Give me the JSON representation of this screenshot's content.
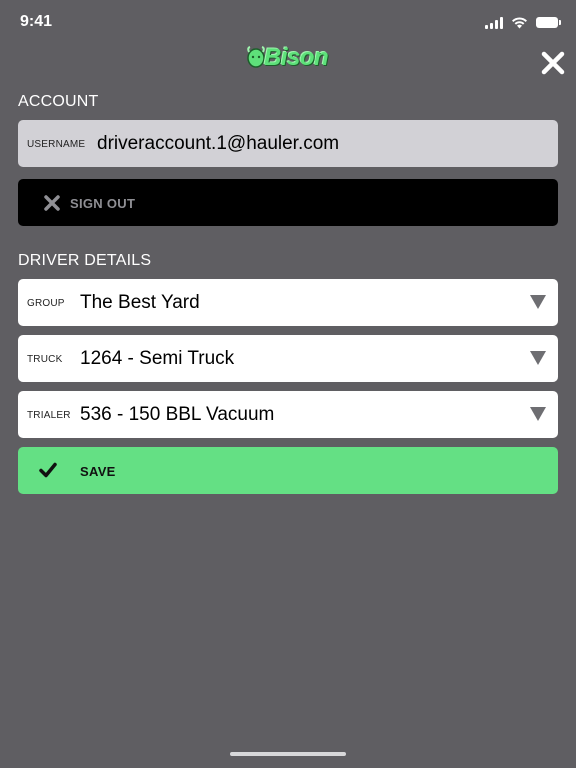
{
  "status_bar": {
    "time": "9:41"
  },
  "header": {
    "logo_text": "Bison",
    "close_icon": "close-icon"
  },
  "account": {
    "heading": "ACCOUNT",
    "username_label": "USERNAME",
    "username_value": "driveraccount.1@hauler.com",
    "signout_label": "SIGN OUT"
  },
  "driver_details": {
    "heading": "DRIVER DETAILS",
    "fields": [
      {
        "label": "GROUP",
        "value": "The Best Yard"
      },
      {
        "label": "TRUCK",
        "value": "1264 - Semi Truck"
      },
      {
        "label": "TRIALER",
        "value": "536 - 150 BBL Vacuum"
      }
    ],
    "save_label": "SAVE"
  },
  "colors": {
    "background": "#5f5e62",
    "accent_green": "#64e084",
    "signout_bg": "#000000",
    "username_bg": "#d2d1d6"
  }
}
